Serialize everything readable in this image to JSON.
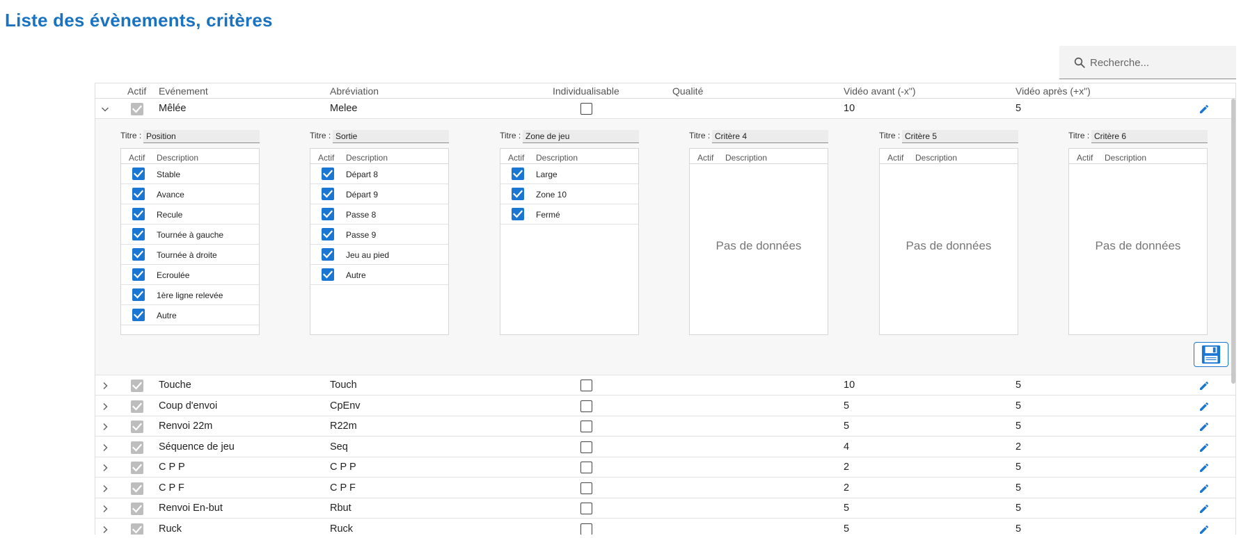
{
  "page": {
    "title": "Liste des évènements, critères"
  },
  "search": {
    "placeholder": "Recherche..."
  },
  "colors": {
    "accent": "#1976d2",
    "title": "#1a73c1"
  },
  "columns": {
    "actif": "Actif",
    "evenement": "Evénement",
    "abreviation": "Abréviation",
    "individualisable": "Individualisable",
    "qualite": "Qualité",
    "video_avant": "Vidéo avant (-x\")",
    "video_apres": "Vidéo après (+x\")"
  },
  "events": [
    {
      "name": "Mêlée",
      "abbr": "Melee",
      "before": "10",
      "after": "5",
      "expanded": true
    },
    {
      "name": "Touche",
      "abbr": "Touch",
      "before": "10",
      "after": "5"
    },
    {
      "name": "Coup d'envoi",
      "abbr": "CpEnv",
      "before": "5",
      "after": "5"
    },
    {
      "name": "Renvoi 22m",
      "abbr": "R22m",
      "before": "5",
      "after": "5"
    },
    {
      "name": "Séquence de jeu",
      "abbr": "Seq",
      "before": "4",
      "after": "2"
    },
    {
      "name": "C P P",
      "abbr": "C P P",
      "before": "2",
      "after": "5"
    },
    {
      "name": "C P F",
      "abbr": "C P F",
      "before": "2",
      "after": "5"
    },
    {
      "name": "Renvoi En-but",
      "abbr": "Rbut",
      "before": "5",
      "after": "5"
    },
    {
      "name": "Ruck",
      "abbr": "Ruck",
      "before": "5",
      "after": "5"
    }
  ],
  "detail": {
    "title_label": "Titre :",
    "col_actif": "Actif",
    "col_description": "Description",
    "no_data": "Pas de données",
    "criteria": [
      {
        "title": "Position",
        "items": [
          "Stable",
          "Avance",
          "Recule",
          "Tournée à gauche",
          "Tournée à droite",
          "Ecroulée",
          "1ère ligne relevée",
          "Autre"
        ]
      },
      {
        "title": "Sortie",
        "items": [
          "Départ 8",
          "Départ 9",
          "Passe 8",
          "Passe 9",
          "Jeu au pied",
          "Autre"
        ]
      },
      {
        "title": "Zone de jeu",
        "items": [
          "Large",
          "Zone 10",
          "Fermé"
        ]
      },
      {
        "title": "Critère 4",
        "items": []
      },
      {
        "title": "Critère 5",
        "items": []
      },
      {
        "title": "Critère 6",
        "items": []
      }
    ]
  }
}
